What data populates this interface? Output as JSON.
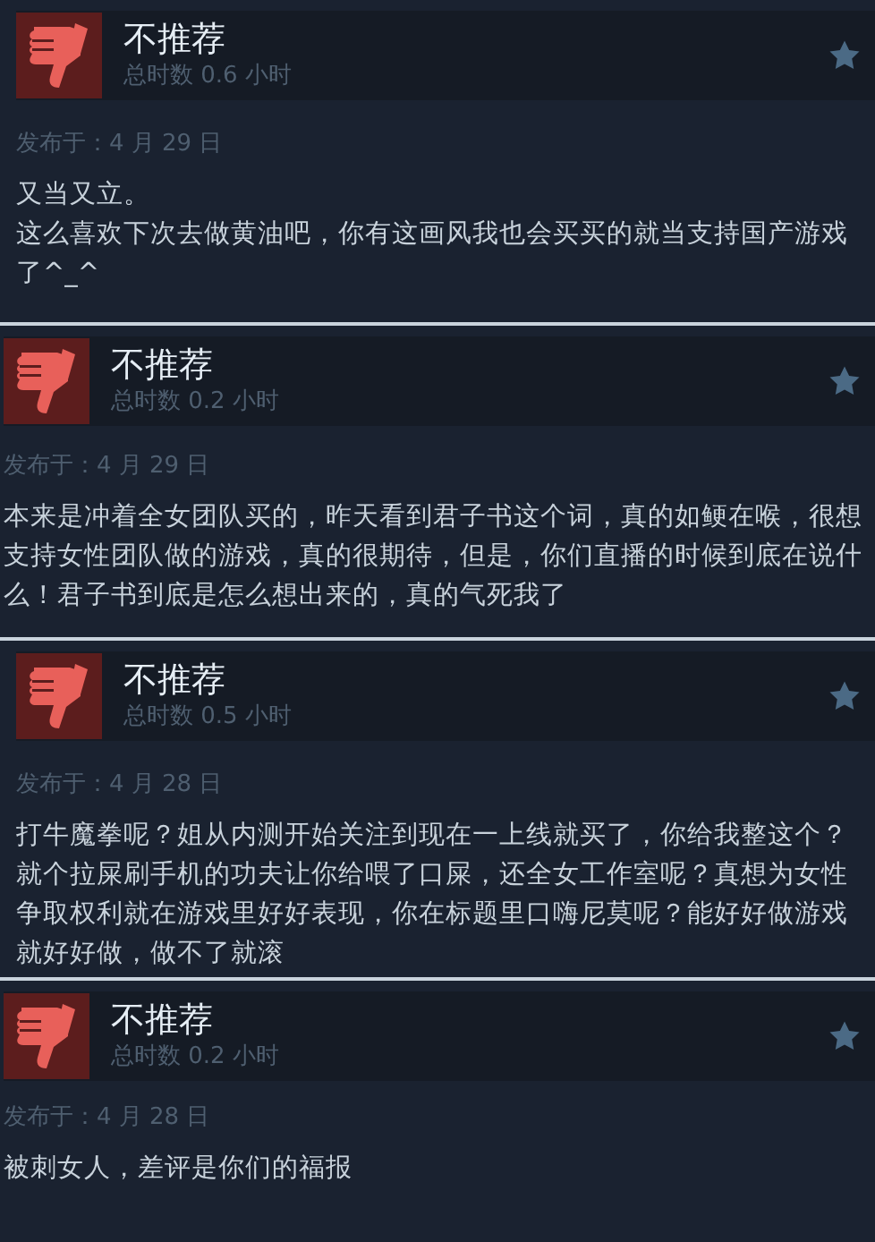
{
  "reviews": [
    {
      "recommended": false,
      "verdict": "不推荐",
      "playtime": "总时数 0.6 小时",
      "posted": "发布于：4 月 29 日",
      "paragraphs": [
        "又当又立。",
        "这么喜欢下次去做黄油吧，你有这画风我也会买买的就当支持国产游戏了^_^"
      ]
    },
    {
      "recommended": false,
      "verdict": "不推荐",
      "playtime": "总时数 0.2 小时",
      "posted": "发布于：4 月 29 日",
      "paragraphs": [
        "本来是冲着全女团队买的，昨天看到君子书这个词，真的如鲠在喉，很想支持女性团队做的游戏，真的很期待，但是，你们直播的时候到底在说什么！君子书到底是怎么想出来的，真的气死我了"
      ]
    },
    {
      "recommended": false,
      "verdict": "不推荐",
      "playtime": "总时数 0.5 小时",
      "posted": "发布于：4 月 28 日",
      "paragraphs": [
        "打牛魔拳呢？姐从内测开始关注到现在一上线就买了，你给我整这个？就个拉屎刷手机的功夫让你给喂了口屎，还全女工作室呢？真想为女性争取权利就在游戏里好好表现，你在标题里口嗨尼莫呢？能好好做游戏就好好做，做不了就滚"
      ]
    },
    {
      "recommended": false,
      "verdict": "不推荐",
      "playtime": "总时数 0.2 小时",
      "posted": "发布于：4 月 28 日",
      "paragraphs": [
        "被刺女人，差评是你们的福报"
      ]
    }
  ]
}
